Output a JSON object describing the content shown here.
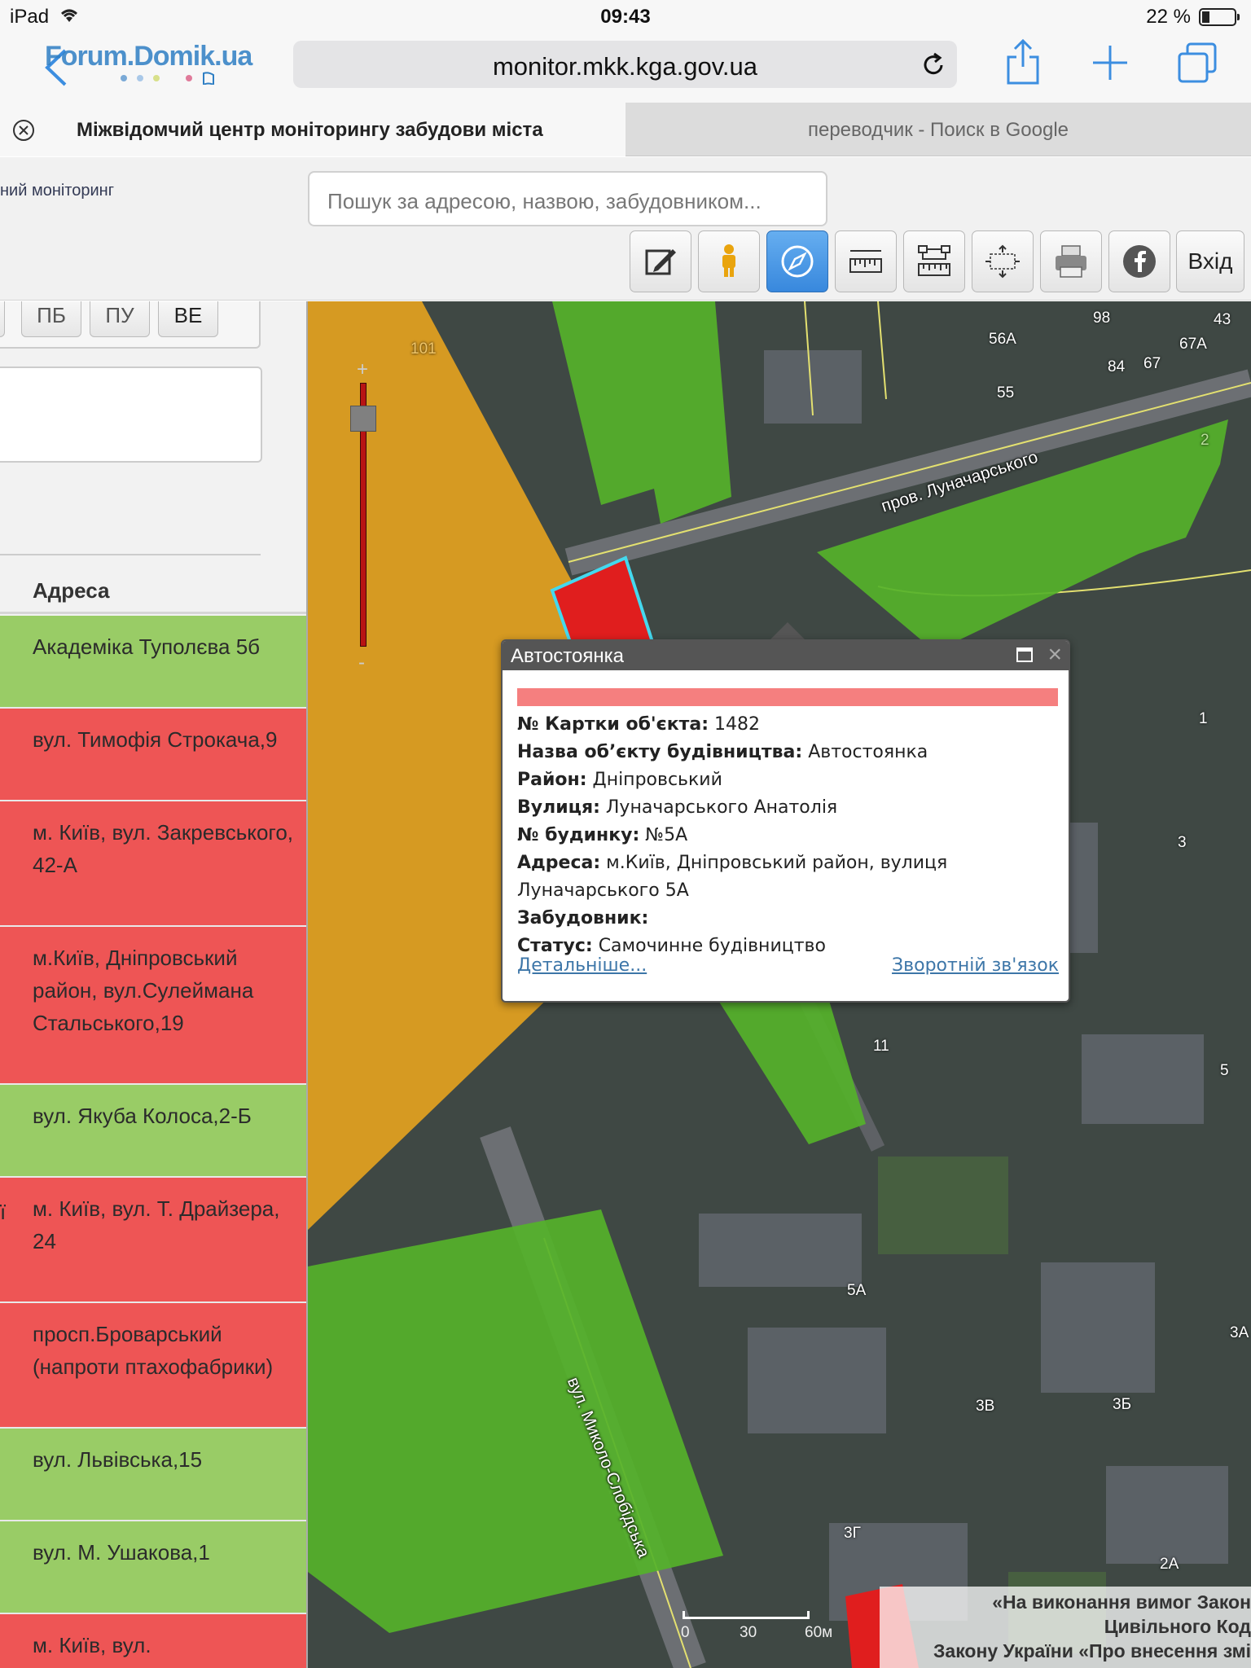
{
  "status_bar": {
    "device": "iPad",
    "time": "09:43",
    "battery_percent": "22 %"
  },
  "browser": {
    "url": "monitor.mkk.kga.gov.ua",
    "watermark": "Forum.Domik.ua",
    "tabs": [
      {
        "title": "Міжвідомчий центр моніторингу забудови міста",
        "active": true
      },
      {
        "title": "переводчик - Поиск в Google",
        "active": false
      }
    ]
  },
  "header": {
    "site_title": "ний моніторинг",
    "search_placeholder": "Пошук за адресою, назвою, забудовником...",
    "tools": [
      "edit-icon",
      "street-view-icon",
      "compass-icon",
      "ruler-icon",
      "area-measure-icon",
      "fullscreen-icon",
      "print-icon",
      "facebook-icon"
    ],
    "active_tool": "compass-icon",
    "login_label": "Вхід"
  },
  "left_panel": {
    "filters": [
      {
        "label": "ПБ",
        "active": false
      },
      {
        "label": "ПУ",
        "active": false
      },
      {
        "label": "ВЕ",
        "active": true
      }
    ],
    "address_header": "Адреса",
    "rows": [
      {
        "status": "green",
        "text": "Академіка Туполєва 5б"
      },
      {
        "status": "red",
        "text": "вул. Тимофія Строкача,9"
      },
      {
        "status": "red",
        "text": "м. Київ, вул. Закревського, 42-А"
      },
      {
        "status": "red",
        "text": "м.Київ, Дніпровський район, вул.Сулеймана Стальського,19"
      },
      {
        "status": "green",
        "text": "вул. Якуба Колоса,2-Б"
      },
      {
        "status": "red",
        "text": "м. Київ, вул. Т. Драйзера, 24",
        "edge": "ї"
      },
      {
        "status": "red",
        "text": "просп.Броварський (напроти птахофабрики)"
      },
      {
        "status": "green",
        "text": "вул. Львівська,15"
      },
      {
        "status": "green",
        "text": "вул. М. Ушакова,1"
      },
      {
        "status": "red",
        "text": "м. Київ, вул."
      }
    ]
  },
  "map": {
    "colors": {
      "orange": "#e3a21f",
      "green": "#55b22a",
      "red": "#e01e1e",
      "highlight": "#44d8ee"
    },
    "zoom": {
      "plus": "+",
      "minus": "-"
    },
    "labels": {
      "street_1": "пров. Луначарського",
      "street_2": "вул. Миколо-Слобідська",
      "parcel_101": "101",
      "h56a": "56А",
      "h98": "98",
      "h43": "43",
      "h67a": "67А",
      "h84": "84",
      "h67": "67",
      "h55": "55",
      "h2": "2",
      "h1": "1",
      "h3": "3",
      "h11": "11",
      "h5": "5",
      "h5a": "5А",
      "h3v": "3В",
      "h3b": "3Б",
      "h3a": "3А",
      "h3g": "3Г",
      "h2a": "2А"
    },
    "scale": {
      "zero": "0",
      "mid": "30",
      "end": "60м"
    }
  },
  "popup": {
    "title": "Автостоянка",
    "fields": [
      {
        "label": "№ Картки об'єкта:",
        "value": "1482"
      },
      {
        "label": "Назва об’єкту будівництва:",
        "value": "Автостоянка"
      },
      {
        "label": "Район:",
        "value": "Дніпровський"
      },
      {
        "label": "Вулиця:",
        "value": "Луначарського Анатолія"
      },
      {
        "label": "№ будинку:",
        "value": "№5А"
      },
      {
        "label": "Адреса:",
        "value": "м.Київ, Дніпровський район, вулиця Луначарського 5А"
      },
      {
        "label": "Забудовник:",
        "value": ""
      },
      {
        "label": "Статус:",
        "value": "Самочинне будівництво"
      }
    ],
    "details_link": "Детальніше...",
    "feedback_link": "Зворотній зв'язок"
  },
  "notice": {
    "line1": "«На виконання вимог Закон",
    "line2": "Цивільного Код",
    "line3": "Закону України «Про внесення змі"
  }
}
